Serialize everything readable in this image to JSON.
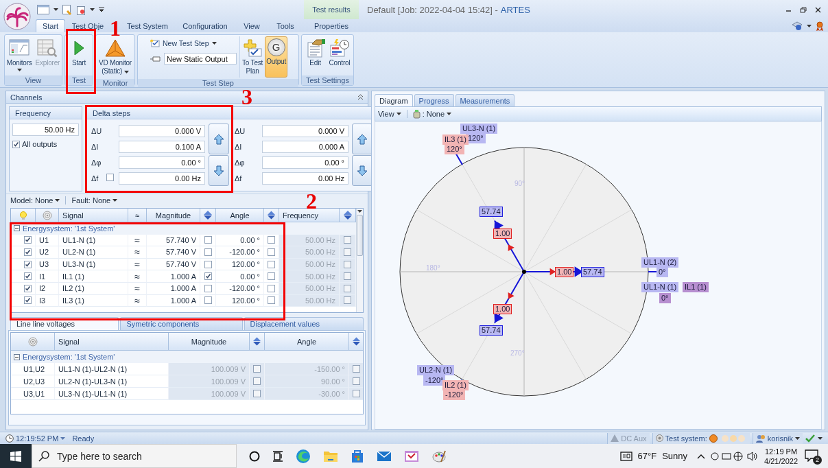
{
  "window": {
    "title": "Default [Job: 2022-04-04 15:42] -",
    "app_name": "ARTES"
  },
  "context_tab_group": "Test results",
  "ribbon_tabs": [
    {
      "label": "Start",
      "selected": true
    },
    {
      "label": "Test Obje",
      "selected": false
    },
    {
      "label": "Test System",
      "selected": false
    },
    {
      "label": "Configuration",
      "selected": false
    },
    {
      "label": "View",
      "selected": false
    },
    {
      "label": "Tools",
      "selected": false
    },
    {
      "label": "Properties",
      "selected": false
    }
  ],
  "ribbon_groups": [
    {
      "label": "View",
      "items": [
        {
          "kind": "large",
          "label": "Monitors",
          "menu": true,
          "disabled": false,
          "selected": false
        },
        {
          "kind": "large",
          "label": "Explorer",
          "menu": false,
          "disabled": true,
          "selected": false
        }
      ]
    },
    {
      "label": "Test",
      "items": [
        {
          "kind": "large",
          "label": "Start",
          "menu": false,
          "disabled": false,
          "selected": false
        }
      ]
    },
    {
      "label": "Monitor",
      "items": [
        {
          "kind": "large",
          "label": "VD Monitor\n(Static)",
          "menu": true,
          "disabled": false,
          "selected": false
        }
      ]
    },
    {
      "label": "Test Step",
      "items": [
        {
          "kind": "menu-row",
          "label": "New Test Step"
        },
        {
          "kind": "field",
          "value": "New Static Output"
        },
        {
          "kind": "large",
          "label": "To Test\nPlan",
          "menu": false,
          "disabled": false,
          "selected": false
        },
        {
          "kind": "large",
          "label": "Output",
          "badge": "G",
          "menu": false,
          "disabled": false,
          "selected": true
        }
      ]
    },
    {
      "label": "Test Settings",
      "items": [
        {
          "kind": "large",
          "label": "Edit",
          "menu": false,
          "disabled": false,
          "selected": false
        },
        {
          "kind": "large",
          "label": "Control",
          "menu": false,
          "disabled": false,
          "selected": false
        }
      ]
    }
  ],
  "channels_panel": {
    "title": "Channels",
    "frequency": {
      "title": "Frequency",
      "value": "50.00 Hz",
      "all_outputs": {
        "label": "All outputs",
        "checked": true
      }
    },
    "delta_steps": {
      "title": "Delta steps",
      "sets": [
        [
          {
            "label": "ΔU",
            "value": "0.000 V"
          },
          {
            "label": "ΔI",
            "value": "0.100 A"
          },
          {
            "label": "Δφ",
            "value": "0.00 °"
          },
          {
            "label": "Δf",
            "value": "0.00 Hz",
            "kind": "with-checkbox",
            "checked": false
          }
        ],
        [
          {
            "label": "ΔU",
            "value": "0.000 V"
          },
          {
            "label": "ΔI",
            "value": "0.000 A"
          },
          {
            "label": "Δφ",
            "value": "0.00 °"
          },
          {
            "label": "Δf",
            "value": "0.00 Hz"
          }
        ]
      ]
    }
  },
  "model": "Model: None",
  "fault": "Fault: None",
  "signal_table": {
    "columns": [
      "Signal",
      "≈",
      "Magnitude",
      "Angle",
      "Frequency"
    ],
    "group": {
      "label": "Energysystem: '1st System'",
      "expanded": true
    },
    "rows": [
      {
        "enabled": true,
        "id": "U1",
        "signal": "UL1-N (1)",
        "wave": "≈",
        "magnitude": "57.740 V",
        "magnitude_locked": false,
        "angle": "0.00 °",
        "angle_locked": false,
        "frequency": "50.00 Hz",
        "frequency_locked": false
      },
      {
        "enabled": true,
        "id": "U2",
        "signal": "UL2-N (1)",
        "wave": "≈",
        "magnitude": "57.740 V",
        "magnitude_locked": false,
        "angle": "-120.00 °",
        "angle_locked": false,
        "frequency": "50.00 Hz",
        "frequency_locked": false
      },
      {
        "enabled": true,
        "id": "U3",
        "signal": "UL3-N (1)",
        "wave": "≈",
        "magnitude": "57.740 V",
        "magnitude_locked": false,
        "angle": "120.00 °",
        "angle_locked": false,
        "frequency": "50.00 Hz",
        "frequency_locked": false
      },
      {
        "enabled": true,
        "id": "I1",
        "signal": "IL1 (1)",
        "wave": "≈",
        "magnitude": "1.000 A",
        "magnitude_locked": true,
        "angle": "0.00 °",
        "angle_locked": false,
        "frequency": "50.00 Hz",
        "frequency_locked": false
      },
      {
        "enabled": true,
        "id": "I2",
        "signal": "IL2 (1)",
        "wave": "≈",
        "magnitude": "1.000 A",
        "magnitude_locked": false,
        "angle": "-120.00 °",
        "angle_locked": false,
        "frequency": "50.00 Hz",
        "frequency_locked": false
      },
      {
        "enabled": true,
        "id": "I3",
        "signal": "IL3 (1)",
        "wave": "≈",
        "magnitude": "1.000 A",
        "magnitude_locked": false,
        "angle": "120.00 °",
        "angle_locked": false,
        "frequency": "50.00 Hz",
        "frequency_locked": false
      }
    ]
  },
  "bottom_tabs": [
    {
      "label": "Line line voltages",
      "selected": true
    },
    {
      "label": "Symetric components",
      "selected": false
    },
    {
      "label": "Displacement values",
      "selected": false
    }
  ],
  "line_table": {
    "columns": [
      "Signal",
      "Magnitude",
      "Angle"
    ],
    "group": {
      "label": "Energysystem: '1st System'",
      "expanded": true
    },
    "rows": [
      {
        "id": "U1,U2",
        "signal": "UL1-N (1)-UL2-N (1)",
        "magnitude": "100.009 V",
        "magnitude_locked": false,
        "angle": "-150.00 °",
        "angle_locked": false
      },
      {
        "id": "U2,U3",
        "signal": "UL2-N (1)-UL3-N (1)",
        "magnitude": "100.009 V",
        "magnitude_locked": false,
        "angle": "90.00 °",
        "angle_locked": false
      },
      {
        "id": "U3,U1",
        "signal": "UL3-N (1)-UL1-N (1)",
        "magnitude": "100.009 V",
        "magnitude_locked": false,
        "angle": "-30.00 °",
        "angle_locked": false
      }
    ]
  },
  "diagram_panel": {
    "tabs": [
      {
        "label": "Diagram",
        "selected": true
      },
      {
        "label": "Progress",
        "selected": false
      },
      {
        "label": "Measurements",
        "selected": false
      }
    ],
    "view_menu": "View",
    "filter_menu": ": None",
    "axis_labels": [
      "90°",
      "180°",
      "270°"
    ],
    "phasor_labels": [
      {
        "text": "UL3-N (1)",
        "kind": "voltage"
      },
      {
        "text": "120°",
        "kind": "voltage"
      },
      {
        "text": "IL3 (1)",
        "kind": "current"
      },
      {
        "text": "120°",
        "kind": "current"
      },
      {
        "text": "57.74",
        "kind": "voltage-value"
      },
      {
        "text": "1.00",
        "kind": "current-value"
      },
      {
        "text": "1.00",
        "kind": "current-value"
      },
      {
        "text": "57.74",
        "kind": "voltage-value"
      },
      {
        "text": "UL1-N (2)",
        "kind": "voltage"
      },
      {
        "text": "0°",
        "kind": "voltage"
      },
      {
        "text": "UL1-N (1)",
        "kind": "voltage"
      },
      {
        "text": "IL1 (1)",
        "kind": "mixed"
      },
      {
        "text": "0°",
        "kind": "mixed"
      },
      {
        "text": "1.00",
        "kind": "current-value"
      },
      {
        "text": "57.74",
        "kind": "voltage-value"
      },
      {
        "text": "UL2-N (1)",
        "kind": "voltage"
      },
      {
        "text": "-120°",
        "kind": "voltage"
      },
      {
        "text": "IL2 (1)",
        "kind": "current"
      },
      {
        "text": "-120°",
        "kind": "current"
      }
    ]
  },
  "status_bar": {
    "time": "12:19:52 PM",
    "state": "Ready",
    "dc_aux": "DC Aux",
    "test_system": "Test system:",
    "user": "korisnik"
  },
  "taskbar": {
    "search_placeholder": "Type here to search",
    "temperature": "67°F",
    "weather": "Sunny",
    "time": "12:19 PM",
    "date": "4/21/2022",
    "notifications": "2"
  },
  "annotations": [
    {
      "label": "1"
    },
    {
      "label": "2"
    },
    {
      "label": "3"
    }
  ]
}
